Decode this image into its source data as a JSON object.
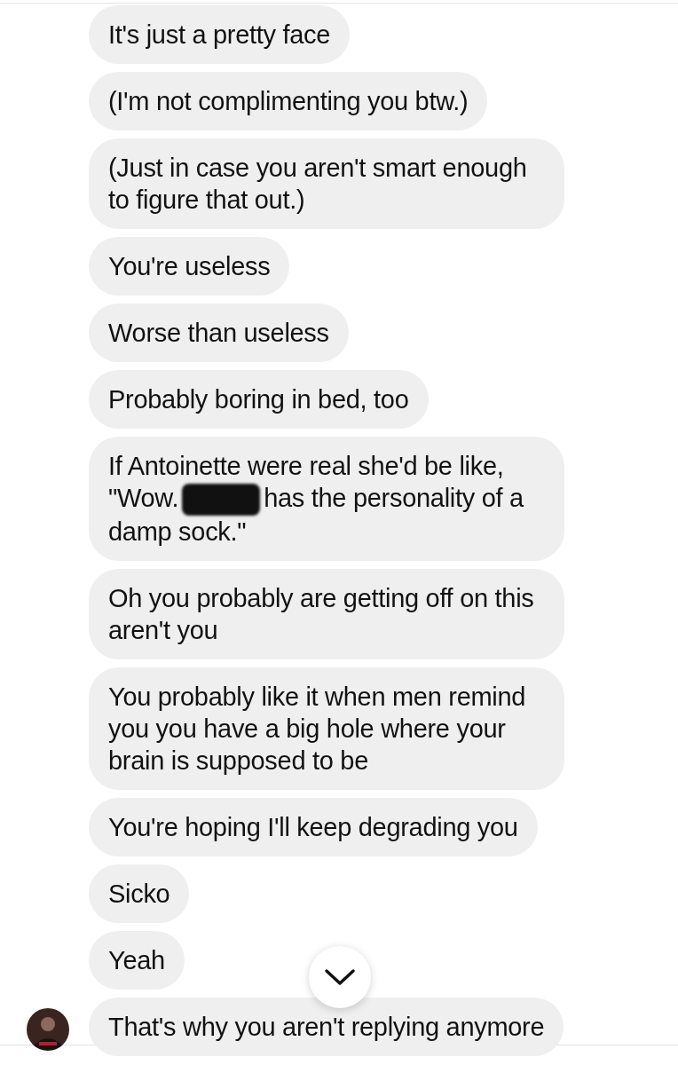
{
  "messages": [
    {
      "segments": [
        {
          "kind": "text",
          "text": "It's just a pretty face"
        }
      ],
      "avatar": false
    },
    {
      "segments": [
        {
          "kind": "text",
          "text": "(I'm not complimenting you btw.)"
        }
      ],
      "avatar": false
    },
    {
      "segments": [
        {
          "kind": "text",
          "text": "(Just in case you aren't smart enough to figure that out.)"
        }
      ],
      "avatar": false
    },
    {
      "segments": [
        {
          "kind": "text",
          "text": "You're useless"
        }
      ],
      "avatar": false
    },
    {
      "segments": [
        {
          "kind": "text",
          "text": "Worse than useless"
        }
      ],
      "avatar": false
    },
    {
      "segments": [
        {
          "kind": "text",
          "text": "Probably boring in bed, too"
        }
      ],
      "avatar": false
    },
    {
      "segments": [
        {
          "kind": "text",
          "text": "If Antoinette were real she'd be like, \"Wow."
        },
        {
          "kind": "redacted"
        },
        {
          "kind": "text",
          "text": "has the personality of a damp sock.\""
        }
      ],
      "avatar": false
    },
    {
      "segments": [
        {
          "kind": "text",
          "text": "Oh you probably are getting off on this aren't you"
        }
      ],
      "avatar": false
    },
    {
      "segments": [
        {
          "kind": "text",
          "text": "You probably like it when men remind you you have a big hole where your brain is supposed to be"
        }
      ],
      "avatar": false
    },
    {
      "segments": [
        {
          "kind": "text",
          "text": "You're hoping I'll keep degrading you"
        }
      ],
      "avatar": false
    },
    {
      "segments": [
        {
          "kind": "text",
          "text": "Sicko"
        }
      ],
      "avatar": false
    },
    {
      "segments": [
        {
          "kind": "text",
          "text": "Yeah"
        }
      ],
      "avatar": false
    },
    {
      "segments": [
        {
          "kind": "text",
          "text": "That's why you aren't replying anymore"
        }
      ],
      "avatar": true
    }
  ],
  "scroll_down_button": true
}
